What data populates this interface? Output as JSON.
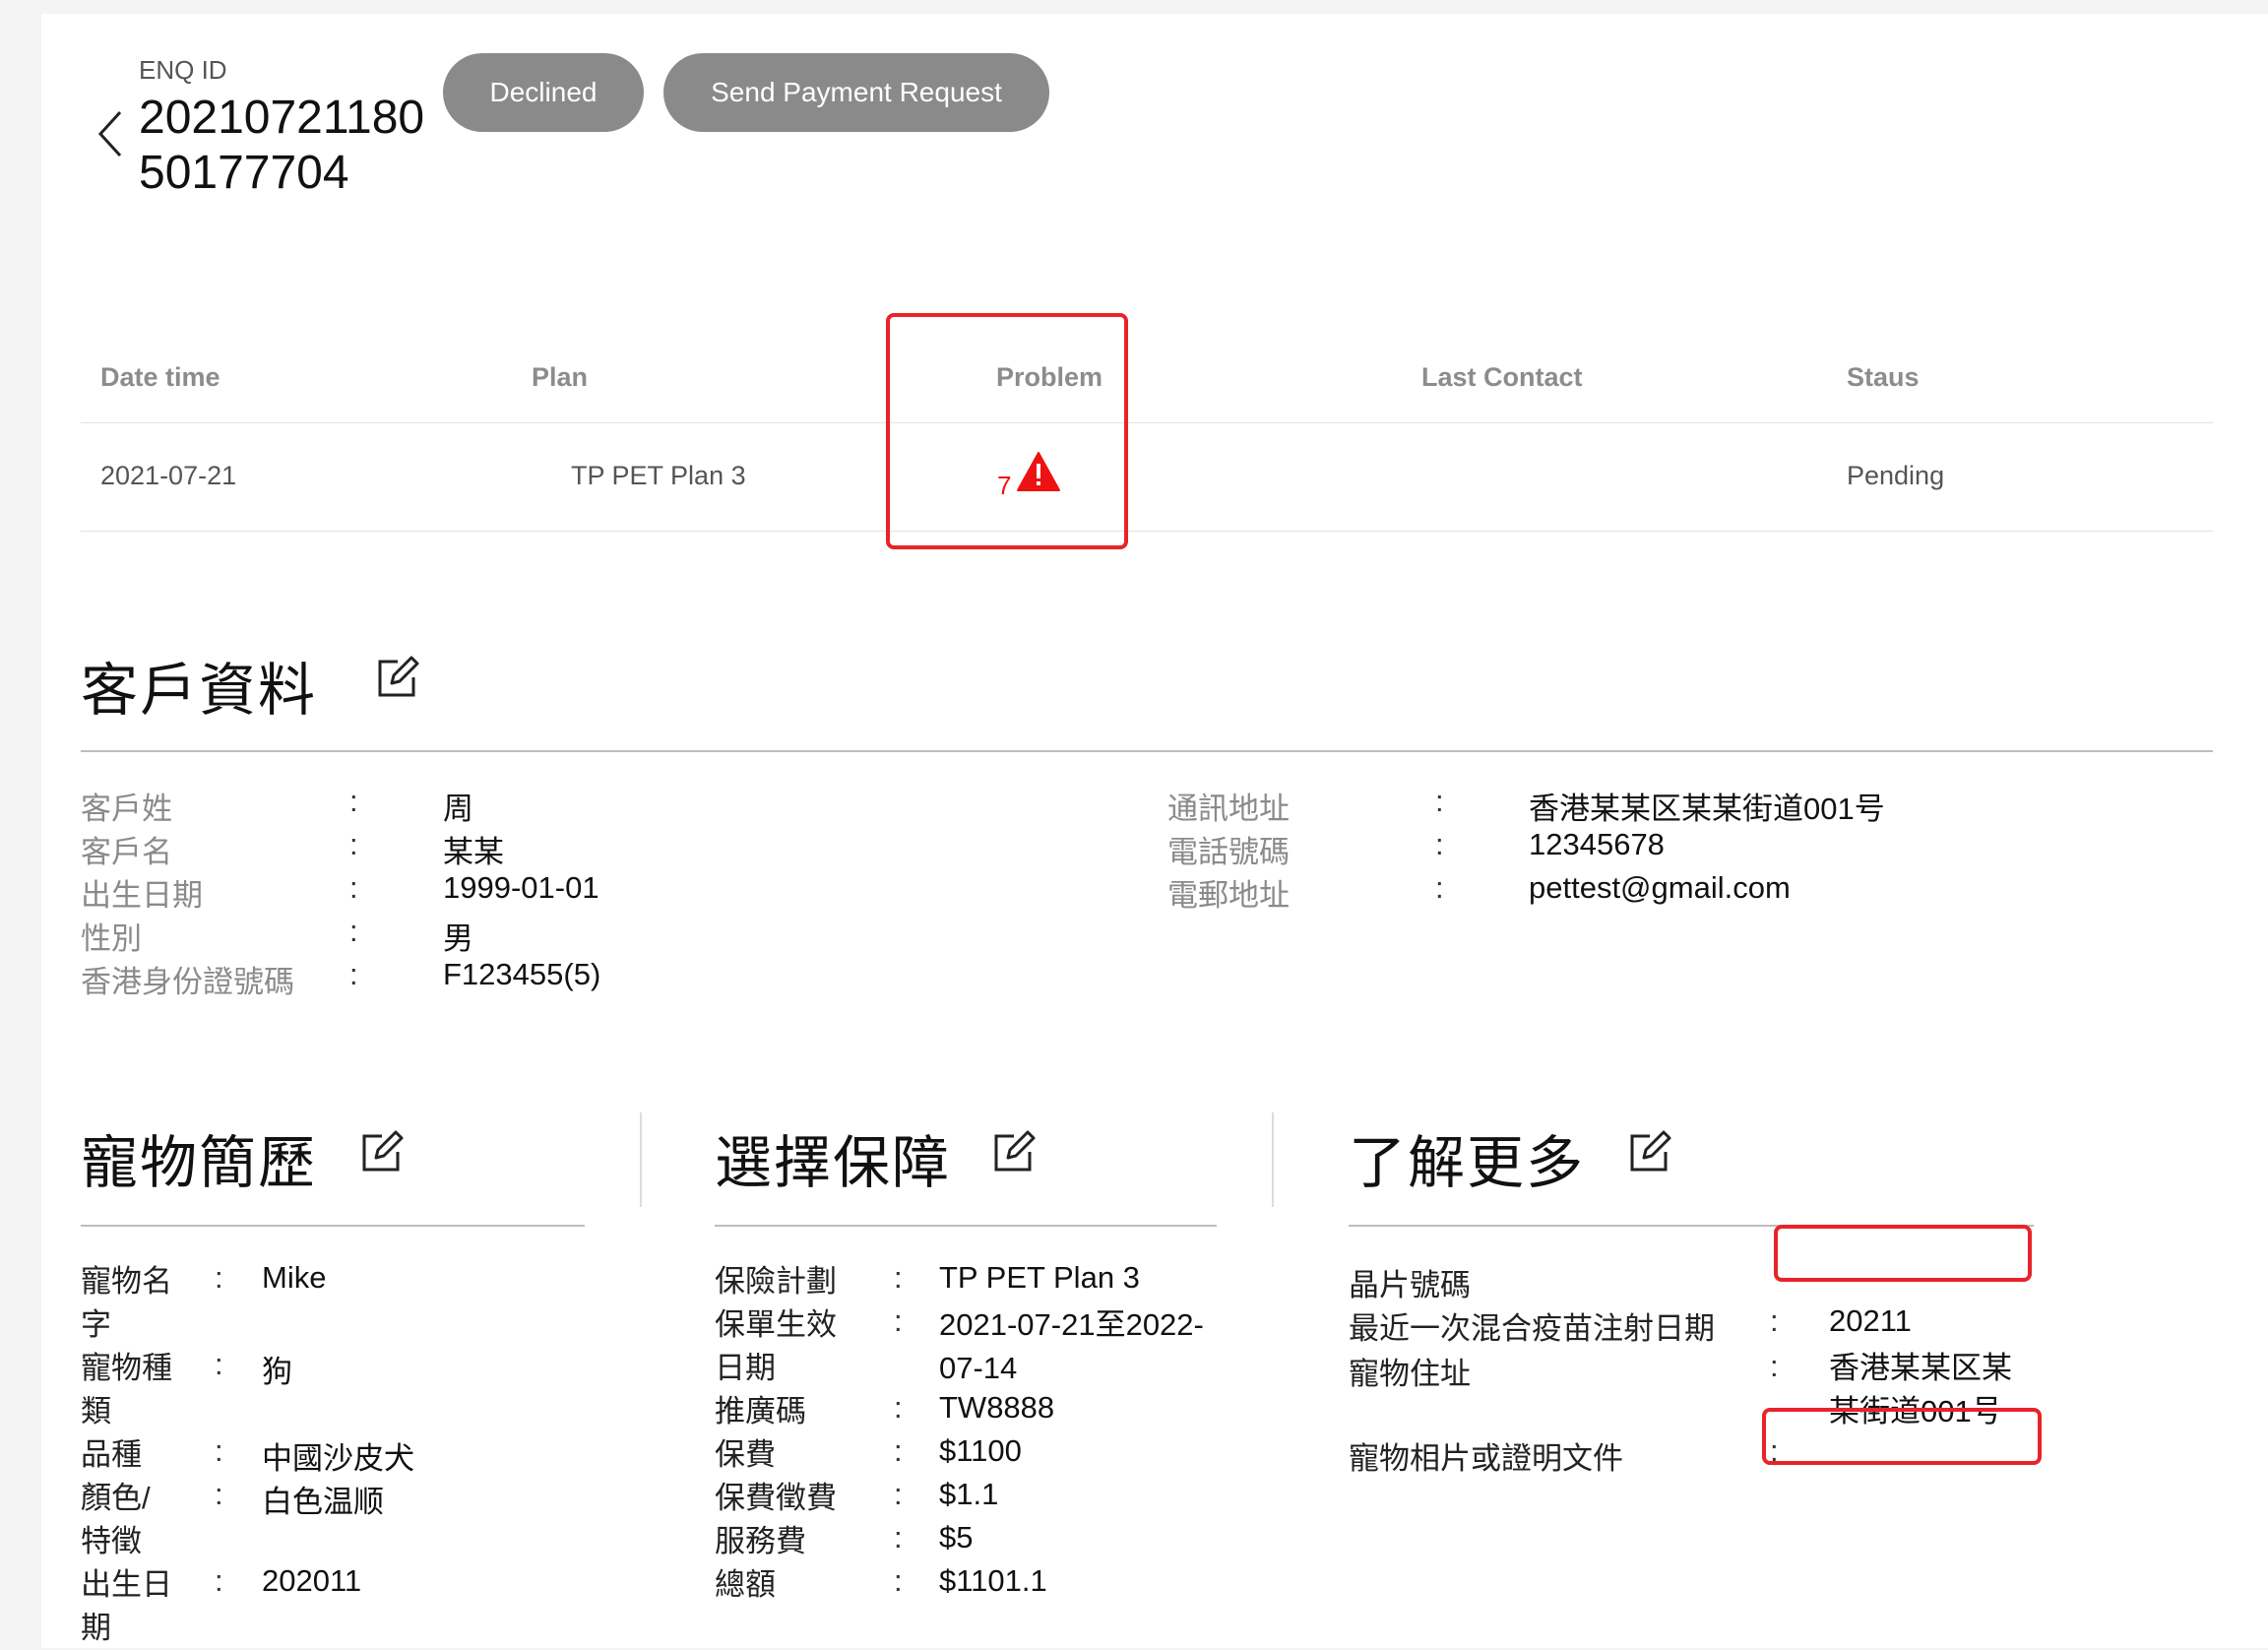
{
  "header": {
    "enq_label": "ENQ ID",
    "enq_id": "2021072118050177704",
    "declined_label": "Declined",
    "payment_label": "Send Payment Request"
  },
  "table": {
    "headers": [
      "Date time",
      "Plan",
      "Problem",
      "Last Contact",
      "Staus"
    ],
    "row": {
      "date": "2021-07-21",
      "plan": "TP PET Plan 3",
      "problem_count": "7",
      "last_contact": "",
      "status": "Pending"
    }
  },
  "customer": {
    "title": "客戶資料",
    "left": [
      {
        "label": "客戶姓",
        "value": "周"
      },
      {
        "label": "客戶名",
        "value": "某某"
      },
      {
        "label": "出生日期",
        "value": "1999-01-01"
      },
      {
        "label": "性別",
        "value": "男"
      },
      {
        "label": "香港身份證號碼",
        "value": "F123455(5)"
      }
    ],
    "right": [
      {
        "label": "通訊地址",
        "value": "香港某某区某某街道001号"
      },
      {
        "label": "電話號碼",
        "value": "12345678"
      },
      {
        "label": "電郵地址",
        "value": "pettest@gmail.com"
      }
    ],
    "colon": ":"
  },
  "pet": {
    "title": "寵物簡歷",
    "fields": [
      {
        "label": "寵物名字",
        "value": "Mike"
      },
      {
        "label": "寵物種類",
        "value": "狗"
      },
      {
        "label": "品種",
        "value": "中國沙皮犬"
      },
      {
        "label": "顏色/特徵",
        "value": "白色温顺"
      },
      {
        "label": "出生日期",
        "value": "202011"
      }
    ]
  },
  "coverage": {
    "title": "選擇保障",
    "fields": [
      {
        "label": "保險計劃",
        "value": "TP PET Plan 3"
      },
      {
        "label": "保單生效日期",
        "value": "2021-07-21至2022-07-14"
      },
      {
        "label": "推廣碼",
        "value": "TW8888"
      },
      {
        "label": "保費",
        "value": "$1100"
      },
      {
        "label": "保費徵費",
        "value": "$1.1"
      },
      {
        "label": "服務費",
        "value": "$5"
      },
      {
        "label": "總額",
        "value": "$1101.1"
      }
    ]
  },
  "more": {
    "title": "了解更多",
    "fields": [
      {
        "label": "晶片號碼",
        "value": ""
      },
      {
        "label": "最近一次混合疫苗注射日期",
        "value": "20211"
      },
      {
        "label": "寵物住址",
        "value": "香港某某区某某街道001号"
      },
      {
        "label": "寵物相片或證明文件",
        "value": ""
      }
    ]
  },
  "colors": {
    "button_bg": "#8a8a8a",
    "alert_red": "#e8232a"
  }
}
